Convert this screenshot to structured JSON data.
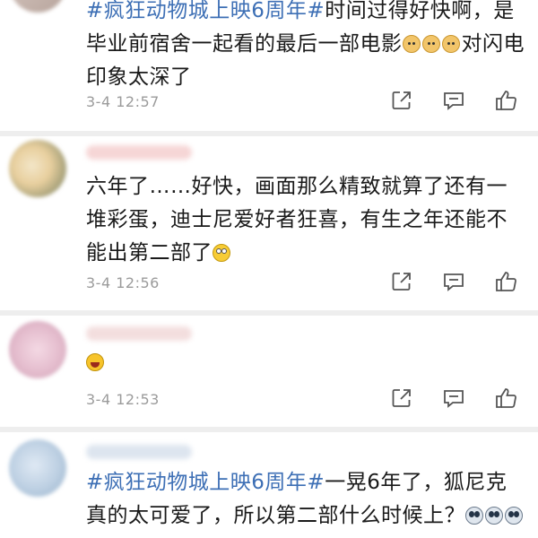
{
  "comments": [
    {
      "segments": [
        {
          "type": "tag",
          "text": "#疯狂动物城上映6周年#"
        },
        {
          "type": "text",
          "text": "时间过得好快啊，是毕业前宿舍一起看的最后一部电影"
        },
        {
          "type": "emoji",
          "name": "dog-face"
        },
        {
          "type": "emoji",
          "name": "dog-face"
        },
        {
          "type": "emoji",
          "name": "dog-face"
        },
        {
          "type": "text",
          "text": "对闪电印象太深了"
        }
      ],
      "time": "3-4 12:57"
    },
    {
      "segments": [
        {
          "type": "text",
          "text": "六年了……好快，画面那么精致就算了还有一堆彩蛋，迪士尼爱好者狂喜，有生之年还能不能出第二部了"
        },
        {
          "type": "emoji",
          "name": "eye-roll-face"
        }
      ],
      "time": "3-4 12:56"
    },
    {
      "segments": [
        {
          "type": "emoji",
          "name": "laughing-face"
        }
      ],
      "time": "3-4 12:53"
    },
    {
      "segments": [
        {
          "type": "tag",
          "text": "#疯狂动物城上映6周年#"
        },
        {
          "type": "text",
          "text": "一晃6年了，狐尼克真的太可爱了，所以第二部什么时候上？"
        },
        {
          "type": "emoji",
          "name": "shocked-face"
        },
        {
          "type": "emoji",
          "name": "shocked-face"
        },
        {
          "type": "emoji",
          "name": "shocked-face"
        }
      ],
      "time": ""
    }
  ],
  "icons": {
    "share": "share-icon",
    "comment": "comment-icon",
    "like": "like-icon"
  },
  "colors": {
    "hashtag": "#3d6fb5",
    "text": "#1a1a1a",
    "meta": "#9b9b9b",
    "divider": "#eeeeee"
  }
}
